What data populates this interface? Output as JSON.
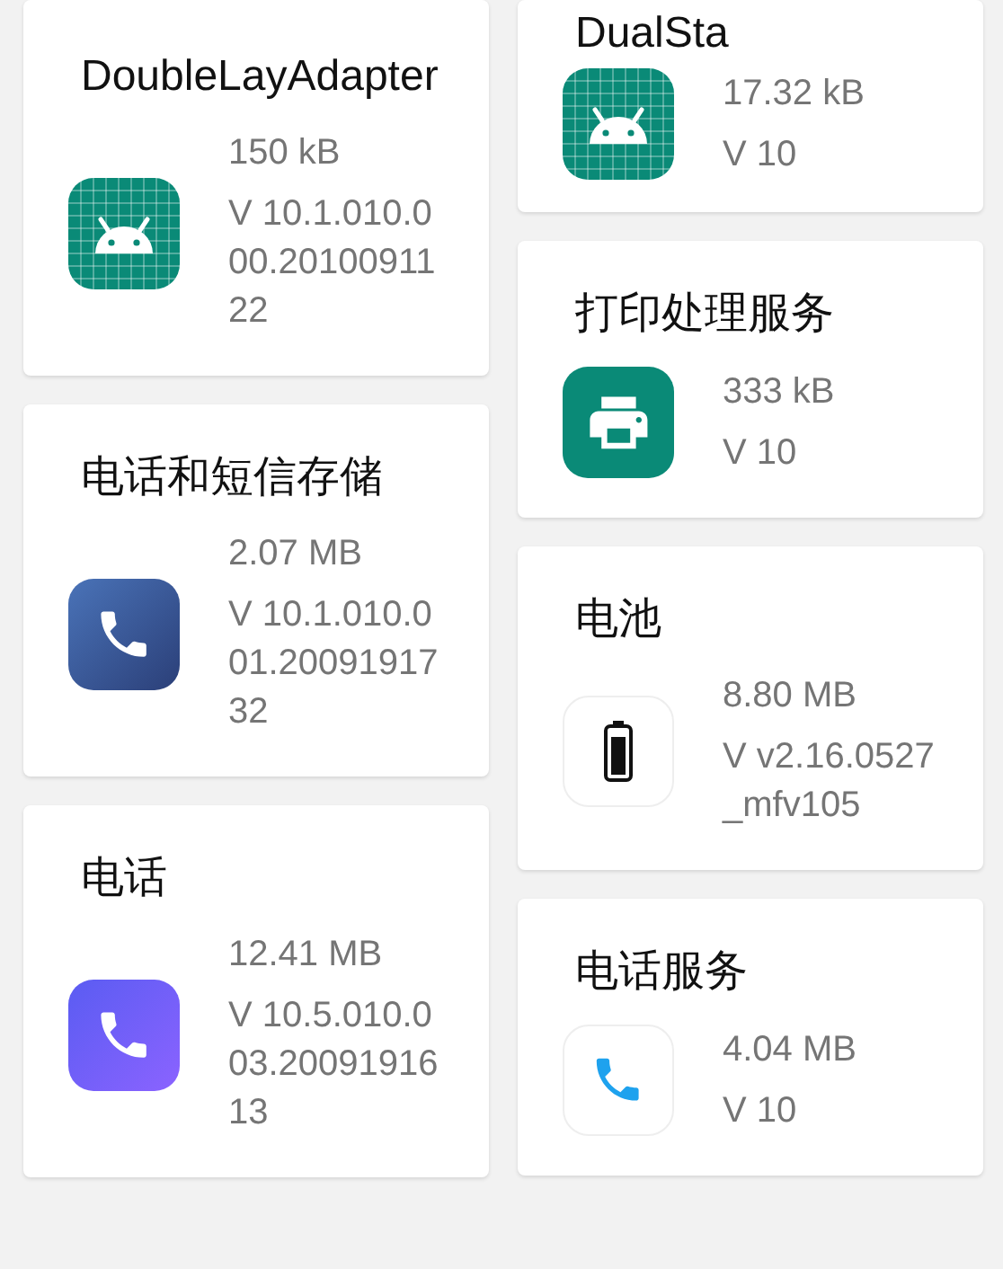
{
  "columns": [
    {
      "cards": [
        {
          "kind": "android",
          "title": "DoubleLayAdapter",
          "size": "150 kB",
          "version": "V 10.1.010.000.2010091122"
        },
        {
          "kind": "phone",
          "title": "电话和短信存储",
          "size": "2.07 MB",
          "version": "V 10.1.010.001.2009191732"
        },
        {
          "kind": "dialer",
          "title": "电话",
          "size": "12.41 MB",
          "version": "V 10.5.010.003.2009191613"
        }
      ]
    },
    {
      "cards": [
        {
          "kind": "android",
          "title": "DualSta",
          "size": "17.32 kB",
          "version": "V 10"
        },
        {
          "kind": "printer",
          "title": "打印处理服务",
          "size": "333 kB",
          "version": "V 10"
        },
        {
          "kind": "battery",
          "title": "电池",
          "size": "8.80 MB",
          "version": "V v2.16.0527_mfv105"
        },
        {
          "kind": "call",
          "title": "电话服务",
          "size": "4.04 MB",
          "version": "V 10"
        }
      ]
    }
  ]
}
